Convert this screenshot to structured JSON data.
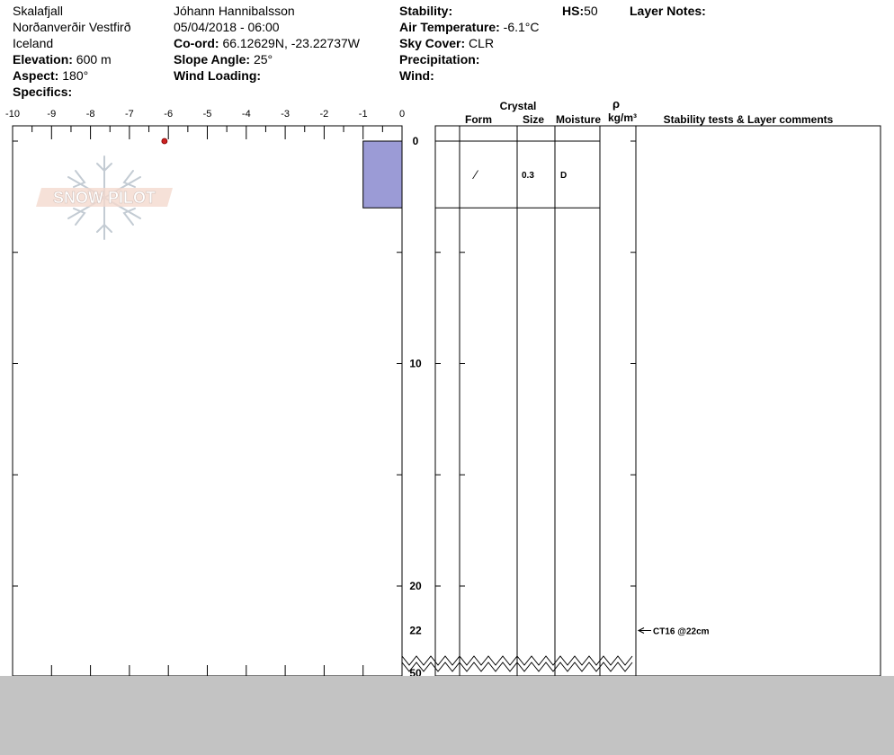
{
  "header": {
    "location": "Skalafjall",
    "region": "Norðanverðir Vestfirð",
    "country": "Iceland",
    "elevation_label": "Elevation:",
    "elevation": "600 m",
    "aspect_label": "Aspect:",
    "aspect": "180°",
    "specifics_label": "Specifics:",
    "observer": "Jóhann Hannibalsson",
    "datetime": "05/04/2018 - 06:00",
    "coord_label": "Co-ord:",
    "coord": "66.12629N, -23.22737W",
    "slope_label": "Slope Angle:",
    "slope": "25°",
    "wind_loading_label": "Wind Loading:",
    "stability_label": "Stability:",
    "air_temp_label": "Air Temperature:",
    "air_temp": "-6.1°C",
    "sky_label": "Sky Cover:",
    "sky": "CLR",
    "precip_label": "Precipitation:",
    "wind_label": "Wind:",
    "hs_label": "HS:",
    "hs": "50",
    "layer_notes_label": "Layer Notes:"
  },
  "columns": {
    "crystal": "Crystal",
    "form": "Form",
    "size": "Size",
    "moisture": "Moisture",
    "rho": "ρ",
    "density_unit": "kg/m³",
    "comments": "Stability tests & Layer comments"
  },
  "logo_text": "SNOW PILOT",
  "colors": {
    "hardness_fill": "#9b9bd6",
    "temp_point": "#cc2222",
    "footer_gray": "#c3c3c3"
  },
  "chart_data": {
    "type": "snow-profile",
    "x_ticks": [
      "-10",
      "-9",
      "-8",
      "-7",
      "-6",
      "-5",
      "-4",
      "-3",
      "-2",
      "-1",
      "0"
    ],
    "xlim": [
      -10,
      0
    ],
    "depth_ticks": [
      "0",
      "10",
      "20",
      "22",
      "50"
    ],
    "temperature_points": [
      {
        "temp": -6.1,
        "depth": 0
      }
    ],
    "layers": [
      {
        "top": 0,
        "bottom": 3,
        "hardness": -1,
        "form": "⁄",
        "size": "0.3",
        "moisture": "D"
      }
    ],
    "tests": [
      {
        "depth": 22,
        "label": "CT16 @22cm"
      }
    ]
  }
}
